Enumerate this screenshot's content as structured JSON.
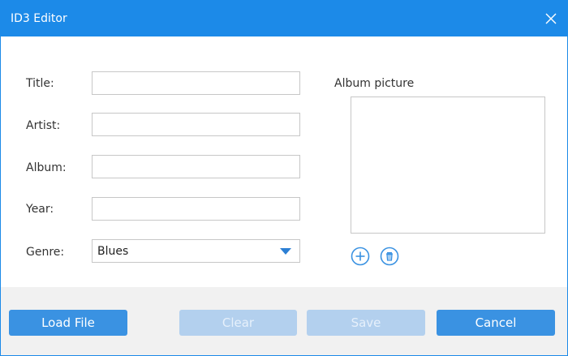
{
  "window": {
    "title": "ID3 Editor"
  },
  "form": {
    "title_label": "Title:",
    "title_value": "",
    "artist_label": "Artist:",
    "artist_value": "",
    "album_label": "Album:",
    "album_value": "",
    "year_label": "Year:",
    "year_value": "",
    "genre_label": "Genre:",
    "genre_value": "Blues"
  },
  "album_picture": {
    "label": "Album picture"
  },
  "footer": {
    "load_label": "Load File",
    "clear_label": "Clear",
    "save_label": "Save",
    "cancel_label": "Cancel"
  },
  "colors": {
    "accent": "#1c8ae8",
    "button": "#3a92e2",
    "button_disabled": "#b3d0ee",
    "footer_bg": "#f1f1f1"
  },
  "icons": {
    "close": "close-icon",
    "dropdown": "chevron-down-icon",
    "add": "plus-circle-icon",
    "delete": "trash-circle-icon"
  }
}
